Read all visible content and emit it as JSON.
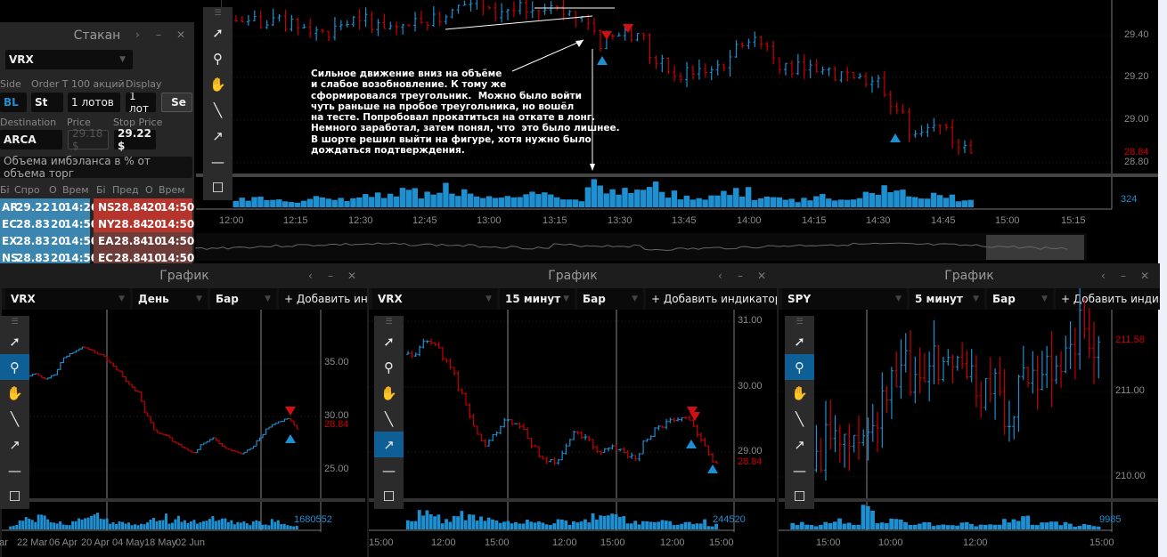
{
  "main_chart": {
    "price_ticks": [
      "29.40",
      "29.20",
      "29.00",
      "28.80"
    ],
    "last_price": "28.84",
    "volume_label": "324",
    "time_ticks": [
      "12:00",
      "12:15",
      "12:30",
      "12:45",
      "13:00",
      "13:15",
      "13:30",
      "13:45",
      "14:00",
      "14:15",
      "14:30",
      "14:45",
      "15:00",
      "15:15"
    ],
    "closes": [
      29.47,
      29.45,
      29.43,
      29.44,
      29.42,
      29.45,
      29.47,
      29.46,
      29.44,
      29.48,
      29.5,
      29.52,
      29.55,
      29.53,
      29.52,
      29.51,
      29.52,
      29.5,
      29.49,
      29.34,
      29.4,
      29.41,
      29.27,
      29.21,
      29.22,
      29.24,
      29.3,
      29.37,
      29.35,
      29.27,
      29.24,
      29.24,
      29.23,
      29.21,
      29.2,
      29.05,
      28.94,
      28.98,
      28.9,
      28.85
    ],
    "volumes": [
      3,
      4,
      3,
      2,
      4,
      3,
      3,
      5,
      4,
      6,
      5,
      8,
      6,
      5,
      4,
      4,
      5,
      4,
      3,
      9,
      7,
      6,
      8,
      5,
      4,
      4,
      5,
      6,
      4,
      4,
      3,
      4,
      3,
      4,
      5,
      8,
      6,
      5,
      4,
      3
    ],
    "annotation": "Сильное движение вниз на объёме\nи слабое возобновление. К тому же\nсформировался треугольник.  Можно было войти\nчуть раньше на пробое треугольника, но вошёл\nна тесте. Попробовал прокатиться на откате в лонг.\nНемного заработал, затем понял, что  это было лишнее.\nВ шорте решил выйти на фигуре, хотя нужно было\nдождаться подтверждения."
  },
  "toolbar_icons": [
    "cursor-icon",
    "zoom-icon",
    "hand-icon",
    "line-icon",
    "arrow-icon",
    "horizontal-line-icon",
    "rectangle-icon"
  ],
  "stakan": {
    "title": "Стакан",
    "symbol": "VRX",
    "labels": {
      "side": "Side",
      "order_type": "Order T",
      "shares": "100 акций",
      "display": "Display",
      "destination": "Destination",
      "price": "Price",
      "stop_price": "Stop Price"
    },
    "side": "BL",
    "order_type": "St",
    "lots": "1 лотов",
    "display_lots": "1 лот",
    "send": "Se",
    "destination": "ARCA",
    "price": "29.18 $",
    "stop_price": "29.22 $",
    "imbalance": "Объема имбэланса в % от объема торг",
    "bid_headers": [
      "Бі",
      "Спро",
      "О",
      "Врем"
    ],
    "ask_headers": [
      "Бі",
      "Пред",
      "О",
      "Врем"
    ],
    "bids": [
      [
        "AR",
        "29.22",
        "10",
        "14:26"
      ],
      [
        "EC",
        "28.83",
        "20",
        "14:50"
      ],
      [
        "EX",
        "28.83",
        "20",
        "14:50"
      ],
      [
        "NS",
        "28.83",
        "20",
        "14:50"
      ]
    ],
    "asks": [
      [
        "NS",
        "28.84",
        "20",
        "14:50"
      ],
      [
        "NY",
        "28.84",
        "20",
        "14:50"
      ],
      [
        "EA",
        "28.84",
        "10",
        "14:50"
      ],
      [
        "EC",
        "28.84",
        "10",
        "14:50"
      ]
    ]
  },
  "panels": [
    {
      "title": "График",
      "symbol": "VRX",
      "interval": "День",
      "type": "Бар",
      "add_indicator": "+ Добавить индикатор",
      "price_ticks": [
        "35.00",
        "30.00",
        "25.00"
      ],
      "last_price": "28.84",
      "volume_label": "1680552",
      "time_ticks": [
        "Mar",
        "22 Mar",
        "06 Apr",
        "20 Apr",
        "04 May",
        "18 May",
        "02 Jun"
      ],
      "closes": [
        33.2,
        33.8,
        34.0,
        33.5,
        33.9,
        35.5,
        36.0,
        36.5,
        36.2,
        35.8,
        35.0,
        34.2,
        33.0,
        32.3,
        30.0,
        28.5,
        28.2,
        27.5,
        27.0,
        26.6,
        27.5,
        28.0,
        27.2,
        26.8,
        26.5,
        27.0,
        28.0,
        29.0,
        29.5,
        29.8,
        28.84
      ],
      "volumes": [
        2,
        5,
        5,
        6,
        4,
        3,
        3,
        4,
        5,
        7,
        4,
        3,
        3,
        2,
        3,
        5,
        6,
        4,
        5,
        4,
        3,
        6,
        5,
        4,
        3,
        3,
        4,
        3,
        4,
        3,
        2
      ]
    },
    {
      "title": "График",
      "symbol": "VRX",
      "interval": "15 минут",
      "type": "Бар",
      "add_indicator": "+ Добавить индикатор",
      "price_ticks": [
        "31.00",
        "30.00",
        "29.00"
      ],
      "last_price": "28.84",
      "volume_label": "244520",
      "time_ticks": [
        "15:00",
        "12:00",
        "15:00",
        "12:00",
        "15:00",
        "12:00",
        "15:00"
      ],
      "closes": [
        30.5,
        30.7,
        30.6,
        30.3,
        29.9,
        29.4,
        29.1,
        29.3,
        29.5,
        29.4,
        29.1,
        28.9,
        28.84,
        29.1,
        29.3,
        29.2,
        29.0,
        29.1,
        29.0,
        28.9,
        29.2,
        29.4,
        29.5,
        29.53,
        29.4,
        29.1,
        28.84
      ],
      "volumes": [
        5,
        7,
        6,
        4,
        8,
        6,
        5,
        5,
        4,
        3,
        4,
        3,
        3,
        4,
        3,
        5,
        7,
        9,
        6,
        4,
        3,
        3,
        4,
        3,
        3,
        4,
        2
      ]
    },
    {
      "title": "График",
      "symbol": "SPY",
      "interval": "5 минут",
      "type": "Бар",
      "add_indicator": "+ Добавить индикатор",
      "price_ticks": [
        "211.00",
        "210.00"
      ],
      "last_price": "211.58",
      "volume_label": "9985",
      "time_ticks": [
        "15:00",
        "10:00",
        "12:00",
        "15:00"
      ],
      "closes": [
        210.27,
        210.3,
        210.45,
        210.5,
        210.4,
        210.6,
        210.9,
        211.31,
        211.2,
        211.3,
        211.35,
        211.4,
        211.3,
        211.15,
        211.0,
        210.7,
        211.1,
        211.2,
        211.3,
        211.55,
        211.73,
        211.58
      ],
      "volumes": [
        3,
        2,
        3,
        4,
        3,
        10,
        3,
        4,
        3,
        3,
        2,
        2,
        3,
        2,
        2,
        4,
        5,
        3,
        3,
        3,
        2,
        2
      ]
    }
  ],
  "colors": {
    "up": "#1e8fd0",
    "down": "#c80000",
    "accent": "#0e5f96"
  }
}
